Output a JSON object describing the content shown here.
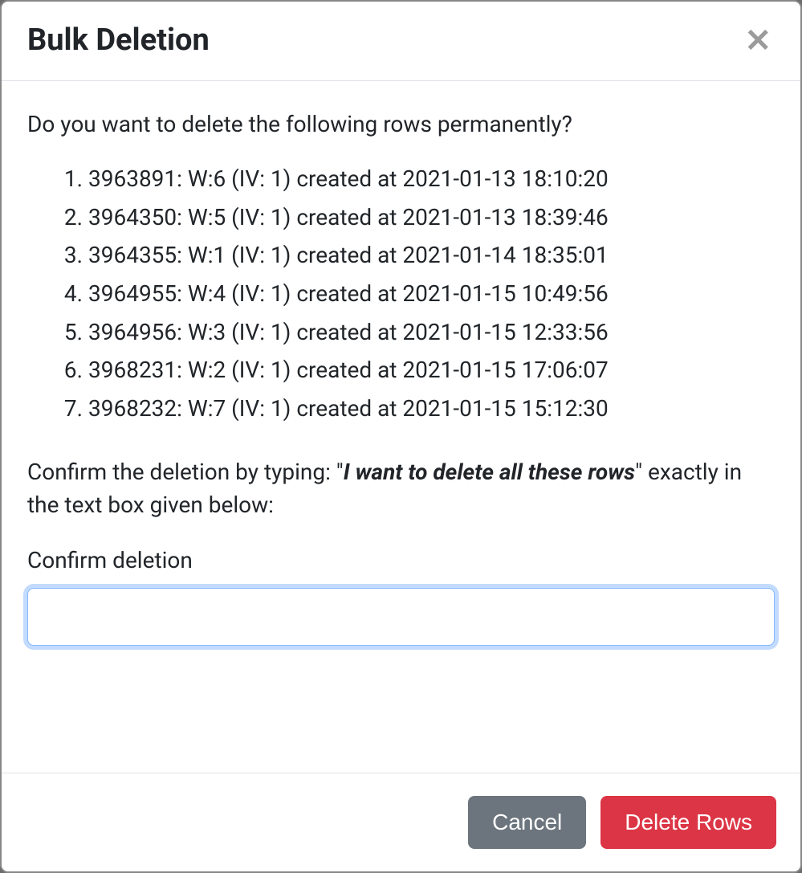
{
  "modal": {
    "title": "Bulk Deletion",
    "prompt": "Do you want to delete the following rows permanently?",
    "rows": [
      "3963891: W:6 (IV: 1) created at 2021-01-13 18:10:20",
      "3964350: W:5 (IV: 1) created at 2021-01-13 18:39:46",
      "3964355: W:1 (IV: 1) created at 2021-01-14 18:35:01",
      "3964955: W:4 (IV: 1) created at 2021-01-15 10:49:56",
      "3964956: W:3 (IV: 1) created at 2021-01-15 12:33:56",
      "3968231: W:2 (IV: 1) created at 2021-01-15 17:06:07",
      "3968232: W:7 (IV: 1) created at 2021-01-15 15:12:30"
    ],
    "confirm_prefix": "Confirm the deletion by typing: \"",
    "confirm_phrase": "I want to delete all these rows",
    "confirm_suffix": "\" exactly in the text box given below:",
    "field_label": "Confirm deletion",
    "input_value": "",
    "buttons": {
      "cancel": "Cancel",
      "delete": "Delete Rows"
    }
  }
}
